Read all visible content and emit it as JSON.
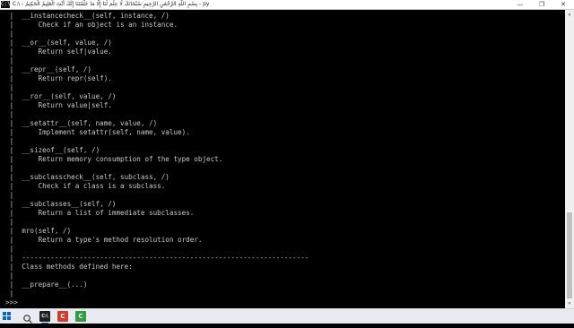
{
  "window": {
    "icon_text": "C:\\",
    "title": "C:\\ - بِسْمِ اللَّهِ الرَّحْمَٰنِ الرَّحِيمِ سُبْحَانَكَ لَا عِلْمَ لَنَا إِلَّا مَا عَلَّمْتَنَا إِنَّكَ أَنْتَ الْعَلِيمُ الْحَكِيمُ - py",
    "minimize_glyph": "—",
    "maximize_glyph": "❐",
    "close_glyph": "✕"
  },
  "console": {
    "lines": [
      " |  __instancecheck__(self, instance, /)",
      " |      Check if an object is an instance.",
      " |",
      " |  __or__(self, value, /)",
      " |      Return self|value.",
      " |",
      " |  __repr__(self, /)",
      " |      Return repr(self).",
      " |",
      " |  __ror__(self, value, /)",
      " |      Return value|self.",
      " |",
      " |  __setattr__(self, name, value, /)",
      " |      Implement setattr(self, name, value).",
      " |",
      " |  __sizeof__(self, /)",
      " |      Return memory consumption of the type object.",
      " |",
      " |  __subclasscheck__(self, subclass, /)",
      " |      Check if a class is a subclass.",
      " |",
      " |  __subclasses__(self, /)",
      " |      Return a list of immediate subclasses.",
      " |",
      " |  mro(self, /)",
      " |      Return a type's method resolution order.",
      " |",
      " |  ----------------------------------------------------------------------",
      " |  Class methods defined here:",
      " |",
      " |  __prepare__(...)",
      " |",
      ">>> "
    ]
  },
  "scrollbar": {
    "up_glyph": "▲",
    "down_glyph": "▼"
  },
  "taskbar": {
    "search_icon": "search-icon",
    "apps": [
      {
        "name": "python-console",
        "glyph": "C:\\",
        "color": "#1e1e1e",
        "active": true
      },
      {
        "name": "app-red",
        "glyph": "C",
        "color": "#d23c28",
        "active": false
      },
      {
        "name": "app-green",
        "glyph": "C",
        "color": "#2e9e3e",
        "active": false
      }
    ]
  },
  "colors": {
    "console_bg": "#000000",
    "console_text": "#c8c8c8",
    "taskbar_bg": "#e8ecf2",
    "accent": "#0a64c8"
  }
}
